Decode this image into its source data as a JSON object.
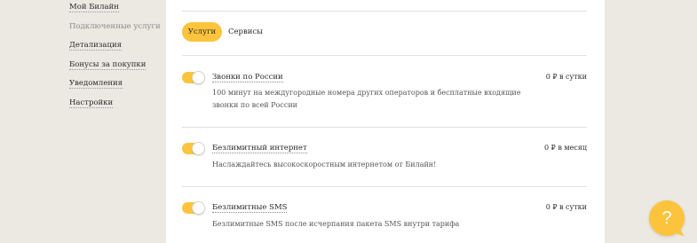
{
  "sidebar": {
    "items": [
      {
        "label": "Мой Билайн"
      },
      {
        "label": "Подключенные услуги"
      },
      {
        "label": "Детализация"
      },
      {
        "label": "Бонусы за покупки"
      },
      {
        "label": "Уведомления"
      },
      {
        "label": "Настройки"
      }
    ]
  },
  "tabs": [
    {
      "label": "Услуги",
      "selected": true
    },
    {
      "label": "Сервисы",
      "selected": false
    }
  ],
  "services": [
    {
      "title": "Звонки по России",
      "price": "0 ₽ в сутки",
      "description": "100 минут на междугородные номера других операторов и бесплатные входящие звонки по всей России",
      "enabled": true
    },
    {
      "title": "Безлимитный интернет",
      "price": "0 ₽ в месяц",
      "description": "Наслаждайтесь высокоскоростным интернетом от Билайн!",
      "enabled": true
    },
    {
      "title": "Безлимитные SMS",
      "price": "0 ₽ в сутки",
      "description": "Безлимитные SMS после исчерпания пакета SMS внутри тарифа",
      "enabled": true
    }
  ],
  "help": {
    "symbol": "?"
  },
  "colors": {
    "accent": "#fcc43c",
    "background": "#ece8e2",
    "card": "#ffffff"
  }
}
